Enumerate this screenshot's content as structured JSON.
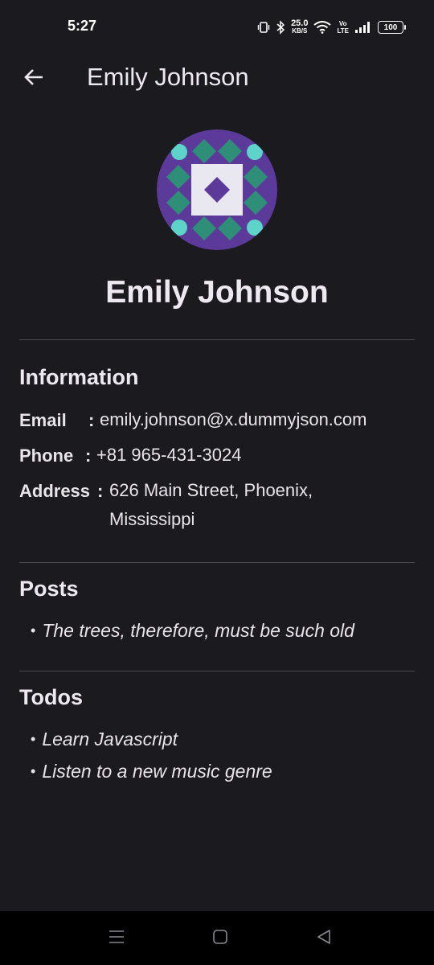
{
  "status_bar": {
    "time": "5:27",
    "speed_value": "25.0",
    "speed_unit": "KB/S",
    "volte_top": "Vo",
    "volte_bottom": "LTE",
    "battery": "100",
    "icons": [
      "vibrate-icon",
      "bluetooth-icon",
      "wifi-icon",
      "signal-icon",
      "battery-icon"
    ]
  },
  "app_bar": {
    "title": "Emily Johnson",
    "back_icon": "arrow-left-icon"
  },
  "profile": {
    "name": "Emily Johnson",
    "avatar_colors": {
      "background": "#5b3a9a",
      "tile": "#2e8e78",
      "dot": "#5dd3c9",
      "center": "#e9e7ef",
      "center_diamond": "#5b3a9a"
    }
  },
  "information": {
    "title": "Information",
    "email_label": "Email",
    "email_value": "emily.johnson@x.dummyjson.com",
    "phone_label": "Phone",
    "phone_value": "+81 965-431-3024",
    "address_label": "Address",
    "address_line1": "626 Main Street, Phoenix,",
    "address_line2": "Mississippi",
    "separator": ":"
  },
  "posts": {
    "title": "Posts",
    "items": [
      "The trees, therefore, must be such old"
    ]
  },
  "todos": {
    "title": "Todos",
    "items": [
      "Learn Javascript",
      "Listen to a new music genre"
    ]
  },
  "bullet": "•",
  "nav_bar": {
    "icons": [
      "menu-icon",
      "home-icon",
      "back-triangle-icon"
    ]
  },
  "colors": {
    "background": "#1b1a1f",
    "text": "#e7e4ea",
    "divider": "#4a474f"
  }
}
